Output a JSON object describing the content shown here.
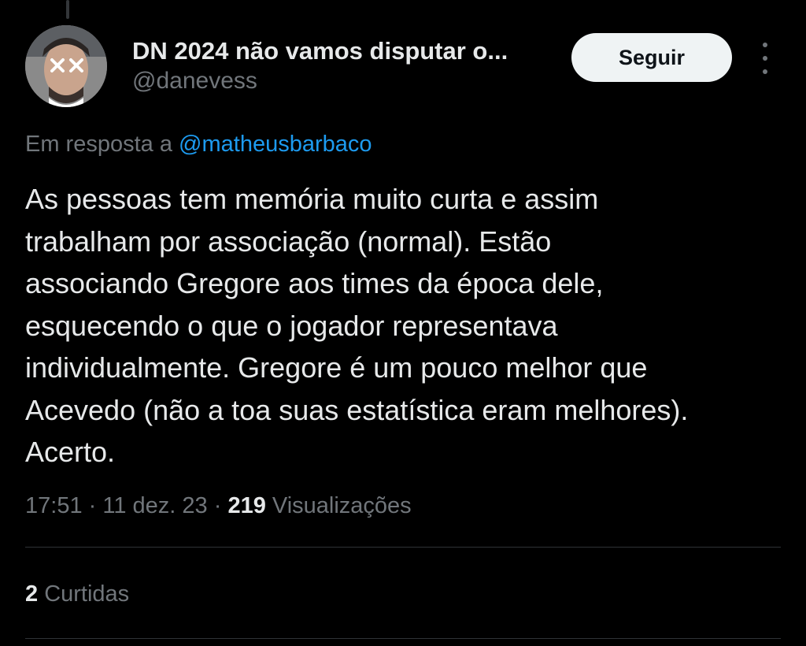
{
  "author": {
    "display_name": "DN 2024 não vamos disputar o...",
    "handle": "@danevess"
  },
  "follow_button": {
    "label": "Seguir"
  },
  "reply": {
    "prefix": "Em resposta a ",
    "mention": "@matheusbarbaco"
  },
  "tweet": {
    "text": "As pessoas tem memória muito curta e assim\ntrabalham por associação (normal). Estão\nassociando Gregore aos times da época dele,\nesquecendo o que o jogador representava\nindividualmente. Gregore é um pouco melhor que\nAcevedo (não a toa suas estatística eram melhores).\nAcerto."
  },
  "meta": {
    "time": "17:51",
    "separator": " · ",
    "date": "11 dez. 23",
    "views_count": "219",
    "views_label": " Visualizações"
  },
  "likes": {
    "count": "2",
    "label": " Curtidas"
  },
  "icons": {
    "more": "more-vertical-icon",
    "avatar": "user-avatar"
  },
  "colors": {
    "background": "#000000",
    "text_primary": "#e7e9ea",
    "text_secondary": "#71767b",
    "link": "#1d9bf0",
    "button_bg": "#eff3f4",
    "divider": "#2f3336"
  }
}
